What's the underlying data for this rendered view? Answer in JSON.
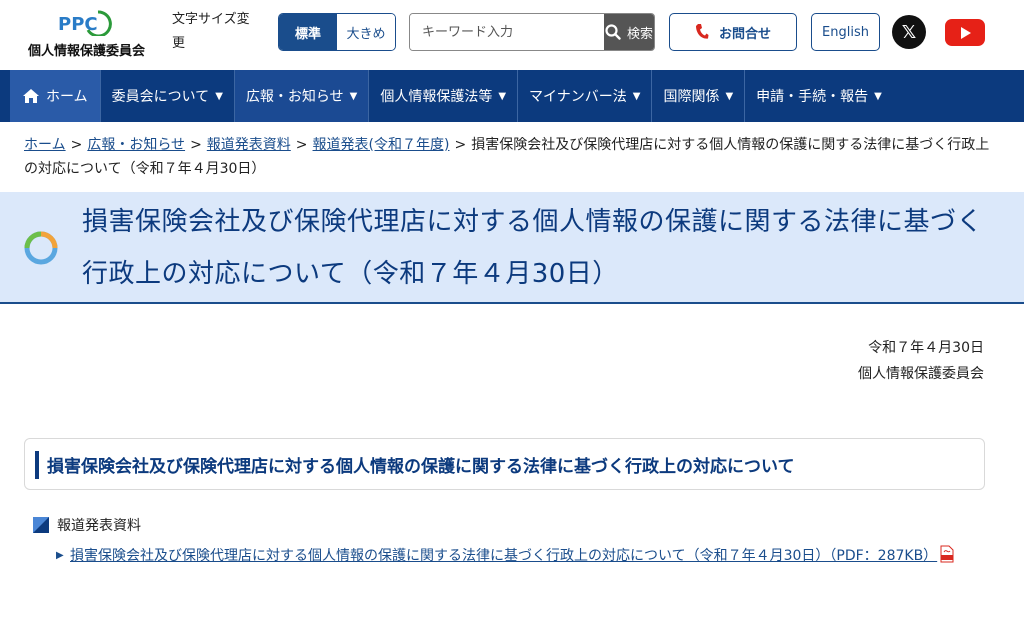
{
  "header": {
    "logo_mark": "PPC",
    "logo_text": "個人情報保護委員会",
    "font_size_label": "文字サイズ変更",
    "font_size_standard": "標準",
    "font_size_large": "大きめ",
    "search_placeholder": "キーワード入力",
    "search_button": "検索",
    "contact_label": "お問合せ",
    "english_label": "English",
    "social_x": "𝕏"
  },
  "nav": {
    "items": [
      {
        "label": "ホーム"
      },
      {
        "label": "委員会について"
      },
      {
        "label": "広報・お知らせ"
      },
      {
        "label": "個人情報保護法等"
      },
      {
        "label": "マイナンバー法"
      },
      {
        "label": "国際関係"
      },
      {
        "label": "申請・手続・報告"
      }
    ]
  },
  "breadcrumb": {
    "links": [
      "ホーム",
      "広報・お知らせ",
      "報道発表資料",
      "報道発表(令和７年度)"
    ],
    "current": "損害保険会社及び保険代理店に対する個人情報の保護に関する法律に基づく行政上の対応について（令和７年４月30日）",
    "separator": ">"
  },
  "page": {
    "title": "損害保険会社及び保険代理店に対する個人情報の保護に関する法律に基づく行政上の対応について（令和７年４月30日）",
    "date": "令和７年４月30日",
    "org": "個人情報保護委員会",
    "section_heading": "損害保険会社及び保険代理店に対する個人情報の保護に関する法律に基づく行政上の対応について",
    "docs_heading": "報道発表資料",
    "doc_link": "損害保険会社及び保険代理店に対する個人情報の保護に関する法律に基づく行政上の対応について（令和７年４月30日）（PDF：287KB）"
  },
  "colors": {
    "brand_navy": "#0c3a7e",
    "title_band": "#dbe8fa",
    "link": "#1a4d8c"
  }
}
